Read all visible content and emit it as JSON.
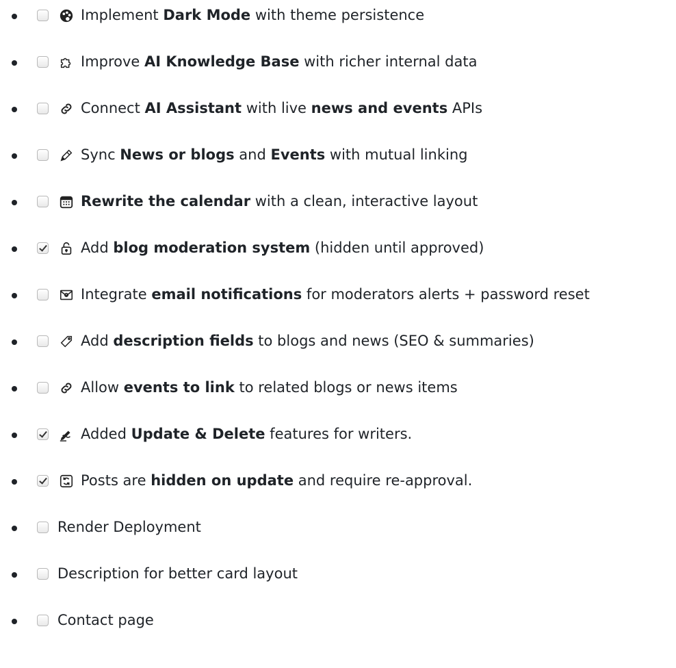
{
  "items": [
    {
      "checked": false,
      "icon": "palette-icon",
      "parts": [
        {
          "t": "Implement "
        },
        {
          "t": "Dark Mode",
          "b": true
        },
        {
          "t": " with theme persistence"
        }
      ]
    },
    {
      "checked": false,
      "icon": "puzzle-icon",
      "parts": [
        {
          "t": "Improve "
        },
        {
          "t": "AI Knowledge Base",
          "b": true
        },
        {
          "t": " with richer internal data"
        }
      ]
    },
    {
      "checked": false,
      "icon": "link-icon",
      "parts": [
        {
          "t": "Connect "
        },
        {
          "t": "AI Assistant",
          "b": true
        },
        {
          "t": " with live "
        },
        {
          "t": "news and events",
          "b": true
        },
        {
          "t": " APIs"
        }
      ]
    },
    {
      "checked": false,
      "icon": "pencil-icon",
      "parts": [
        {
          "t": "Sync "
        },
        {
          "t": "News or blogs",
          "b": true
        },
        {
          "t": " and "
        },
        {
          "t": "Events",
          "b": true
        },
        {
          "t": " with mutual linking"
        }
      ]
    },
    {
      "checked": false,
      "icon": "calendar-icon",
      "parts": [
        {
          "t": "Rewrite the calendar",
          "b": true
        },
        {
          "t": " with a clean, interactive layout"
        }
      ]
    },
    {
      "checked": true,
      "icon": "lock-icon",
      "parts": [
        {
          "t": "Add "
        },
        {
          "t": "blog moderation system",
          "b": true
        },
        {
          "t": " (hidden until approved)"
        }
      ]
    },
    {
      "checked": false,
      "icon": "email-icon",
      "parts": [
        {
          "t": "Integrate "
        },
        {
          "t": "email notifications",
          "b": true
        },
        {
          "t": " for moderators alerts + password reset"
        }
      ]
    },
    {
      "checked": false,
      "icon": "tag-icon",
      "parts": [
        {
          "t": "Add "
        },
        {
          "t": "description fields",
          "b": true
        },
        {
          "t": " to blogs and news (SEO & summaries)"
        }
      ]
    },
    {
      "checked": false,
      "icon": "link-icon",
      "parts": [
        {
          "t": "Allow "
        },
        {
          "t": "events to link",
          "b": true
        },
        {
          "t": " to related blogs or news items"
        }
      ]
    },
    {
      "checked": true,
      "icon": "writing-hand-icon",
      "parts": [
        {
          "t": "Added "
        },
        {
          "t": "Update & Delete",
          "b": true
        },
        {
          "t": " features for writers."
        }
      ]
    },
    {
      "checked": true,
      "icon": "refresh-icon",
      "parts": [
        {
          "t": "Posts are "
        },
        {
          "t": "hidden on update",
          "b": true
        },
        {
          "t": " and require re-approval."
        }
      ]
    },
    {
      "checked": false,
      "icon": "",
      "parts": [
        {
          "t": "Render Deployment"
        }
      ]
    },
    {
      "checked": false,
      "icon": "",
      "parts": [
        {
          "t": "Description for better card layout"
        }
      ]
    },
    {
      "checked": false,
      "icon": "",
      "parts": [
        {
          "t": "Contact page"
        }
      ]
    }
  ]
}
